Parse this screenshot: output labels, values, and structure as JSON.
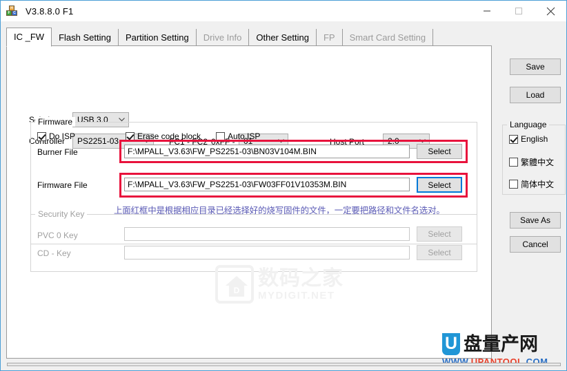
{
  "window": {
    "title": "V3.8.8.0 F1",
    "icon": "app-blocks-icon",
    "controls": {
      "minimize": "minimize-icon",
      "maximize": "maximize-icon",
      "close": "close-icon"
    }
  },
  "tabs": [
    {
      "label": "IC _FW",
      "selected": true,
      "enabled": true
    },
    {
      "label": "Flash Setting",
      "selected": false,
      "enabled": true
    },
    {
      "label": "Partition Setting",
      "selected": false,
      "enabled": true
    },
    {
      "label": "Drive Info",
      "selected": false,
      "enabled": false
    },
    {
      "label": "Other Setting",
      "selected": false,
      "enabled": true
    },
    {
      "label": "FP",
      "selected": false,
      "enabled": false
    },
    {
      "label": "Smart Card Setting",
      "selected": false,
      "enabled": false
    }
  ],
  "form": {
    "solution": {
      "label": "Solution",
      "value": "USB 3.0"
    },
    "controller": {
      "label": "Controller",
      "value": "PS2251-03"
    },
    "fc_label": "FC1 - FC2",
    "fc_prefix": "0xFF -",
    "fc": {
      "value": "01"
    },
    "host_port": {
      "label": "Host Port",
      "value": "2.0"
    }
  },
  "firmware": {
    "group_title": "Firmware",
    "do_isp": {
      "label": "Do ISP",
      "checked": true
    },
    "erase_code_block": {
      "label": "Erase code block",
      "checked": true
    },
    "auto_isp": {
      "label": "Auto ISP",
      "checked": false
    },
    "burner_file": {
      "label": "Burner File",
      "value": "F:\\MPALL_V3.63\\FW_PS2251-03\\BN03V104M.BIN",
      "button": "Select"
    },
    "firmware_file": {
      "label": "Firmware File",
      "value": "F:\\MPALL_V3.63\\FW_PS2251-03\\FW03FF01V10353M.BIN",
      "button": "Select"
    }
  },
  "annotation": {
    "text": "上面红框中是根据相应目录已经选择好的烧写固件的文件，一定要把路径和文件名选对。",
    "color": "#5a5ab5"
  },
  "highlight": {
    "color": "#e8123c"
  },
  "security_key": {
    "group_title": "Security Key",
    "pvc0": {
      "label": "PVC 0 Key",
      "value": "",
      "button": "Select"
    },
    "cdkey": {
      "label": "CD - Key",
      "value": "",
      "button": "Select"
    }
  },
  "sidebar": {
    "save": "Save",
    "load": "Load",
    "language": {
      "group_title": "Language",
      "options": [
        {
          "label": "English",
          "checked": true
        },
        {
          "label": "繁體中文",
          "checked": false
        },
        {
          "label": "简体中文",
          "checked": false
        }
      ]
    },
    "save_as": "Save As",
    "cancel": "Cancel"
  },
  "watermark": {
    "cn": "数码之家",
    "en": "MYDIGIT.NET",
    "icon": "house-logo-icon"
  },
  "brand": {
    "letter": "U",
    "cn": "盘量产网",
    "url_prefix": "WWW.",
    "url_name": "UPANTOOL",
    "url_suffix": ".COM"
  }
}
